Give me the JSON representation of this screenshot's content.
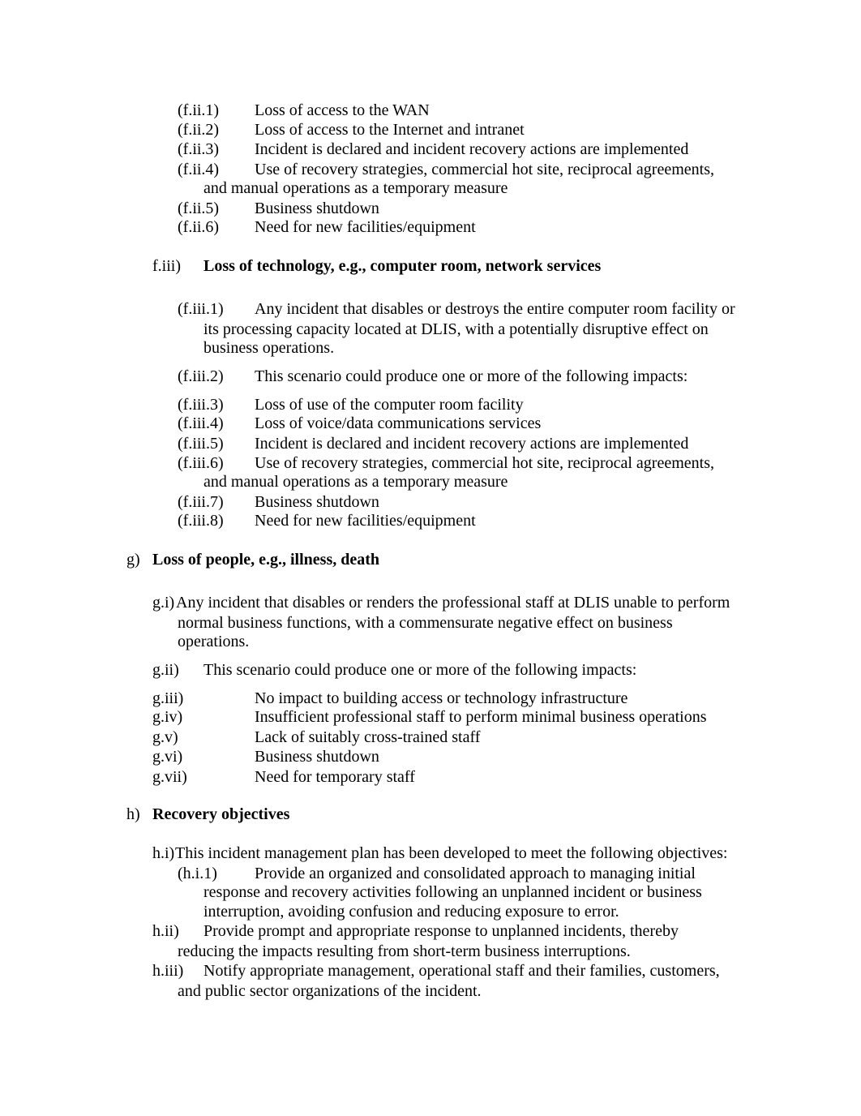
{
  "document": {
    "section_f_ii_items": [
      {
        "num": "(f.ii.1)",
        "lines": [
          "Loss of access to the WAN"
        ]
      },
      {
        "num": "(f.ii.2)",
        "lines": [
          "Loss of access to the Internet and intranet"
        ]
      },
      {
        "num": "(f.ii.3)",
        "lines": [
          "Incident is declared and incident recovery actions are implemented"
        ]
      },
      {
        "num": "(f.ii.4)",
        "lines": [
          "Use of recovery strategies, commercial hot site, reciprocal agreements,",
          "and manual operations as a temporary measure"
        ]
      },
      {
        "num": "(f.ii.5)",
        "lines": [
          "Business shutdown"
        ]
      },
      {
        "num": "(f.ii.6)",
        "lines": [
          "Need for new facilities/equipment"
        ]
      }
    ],
    "section_f_iii": {
      "num": "f.iii)",
      "heading": "Loss of technology, e.g., computer room, network services",
      "items": [
        {
          "num": "(f.iii.1)",
          "lines": [
            "Any incident that disables or destroys the entire computer room facility or",
            "its processing capacity located at DLIS, with a potentially disruptive effect on",
            "business operations."
          ]
        },
        {
          "num": "(f.iii.2)",
          "lines": [
            "This scenario could produce one or more of the following impacts:"
          ]
        },
        {
          "num": "(f.iii.3)",
          "lines": [
            "Loss of use of the computer room facility"
          ]
        },
        {
          "num": "(f.iii.4)",
          "lines": [
            "Loss of voice/data communications services"
          ]
        },
        {
          "num": "(f.iii.5)",
          "lines": [
            "Incident is declared and incident recovery actions are implemented"
          ]
        },
        {
          "num": "(f.iii.6)",
          "lines": [
            "Use of recovery strategies, commercial hot site, reciprocal agreements,",
            "and manual operations as a temporary measure"
          ]
        },
        {
          "num": "(f.iii.7)",
          "lines": [
            "Business shutdown"
          ]
        },
        {
          "num": "(f.iii.8)",
          "lines": [
            "Need for new facilities/equipment"
          ]
        }
      ]
    },
    "section_g": {
      "num": "g)",
      "heading": "Loss of people, e.g., illness, death",
      "items": [
        {
          "num": "g.i)",
          "lines": [
            "Any incident that disables or renders the professional staff at DLIS unable to perform",
            "normal business functions, with a commensurate negative effect on business",
            "operations."
          ]
        },
        {
          "num": "g.ii)",
          "lines": [
            "This scenario could produce one or more of the following impacts:"
          ]
        },
        {
          "num": "g.iii)",
          "lines": [
            "No impact to building access or technology infrastructure"
          ]
        },
        {
          "num": "g.iv)",
          "lines": [
            "Insufficient professional staff to perform minimal business operations"
          ]
        },
        {
          "num": "g.v)",
          "lines": [
            "Lack of suitably cross-trained staff"
          ]
        },
        {
          "num": "g.vi)",
          "lines": [
            "Business shutdown"
          ]
        },
        {
          "num": "g.vii)",
          "lines": [
            "Need for temporary staff"
          ]
        }
      ]
    },
    "section_h": {
      "num": "h)",
      "heading": "Recovery objectives",
      "items": [
        {
          "num": "h.i)",
          "lines": [
            "This incident management plan has been developed to meet the following objectives:"
          ]
        },
        {
          "num": "(h.i.1)",
          "lines": [
            "Provide an organized and consolidated approach to managing initial",
            "response and recovery activities following an unplanned incident or business",
            "interruption, avoiding confusion and reducing exposure to error."
          ]
        },
        {
          "num": "h.ii)",
          "lines": [
            "Provide prompt and appropriate response to unplanned incidents, thereby",
            "reducing the impacts resulting from short-term business interruptions."
          ]
        },
        {
          "num": "h.iii)",
          "lines": [
            "Notify appropriate management, operational staff and their families, customers,",
            "and public sector organizations of the incident."
          ]
        }
      ]
    }
  }
}
